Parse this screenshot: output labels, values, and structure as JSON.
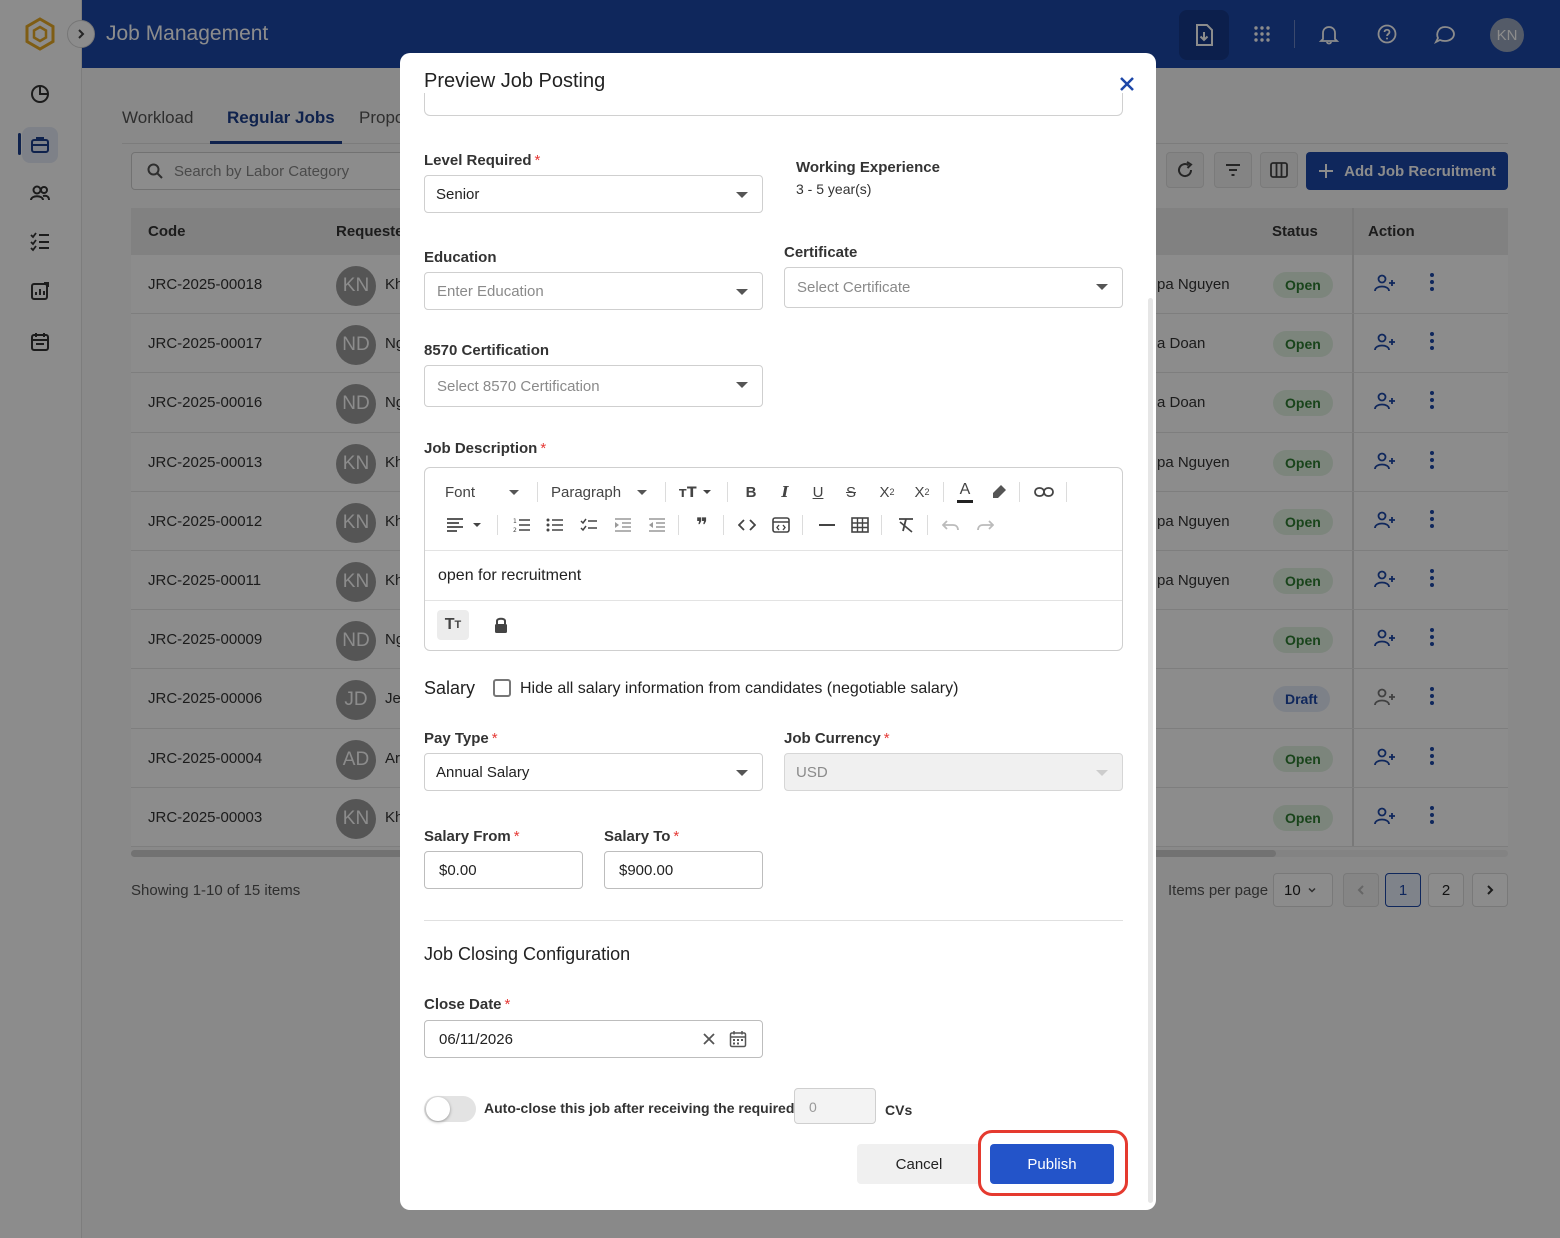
{
  "app": {
    "title": "Job Management",
    "user_initials": "KN",
    "brand_color": "#1d47a8"
  },
  "sidebar": {
    "icons": [
      "dashboard-icon",
      "briefcase-icon",
      "users-icon",
      "checklist-icon",
      "report-icon",
      "calendar-icon"
    ]
  },
  "tabs": [
    {
      "label": "Workload"
    },
    {
      "label": "Regular Jobs"
    },
    {
      "label": "Propo"
    }
  ],
  "search": {
    "placeholder": "Search by Labor Category"
  },
  "toolbar": {
    "add_label": "Add Job Recruitment"
  },
  "table": {
    "headers": {
      "code": "Code",
      "requester": "Requeste",
      "status": "Status",
      "action": "Action"
    },
    "rows": [
      {
        "code": "JRC-2025-00018",
        "initials": "KN",
        "name": "Kh",
        "requester": "pa Nguyen",
        "status": "Open"
      },
      {
        "code": "JRC-2025-00017",
        "initials": "ND",
        "name": "Ng",
        "requester": "a Doan",
        "status": "Open"
      },
      {
        "code": "JRC-2025-00016",
        "initials": "ND",
        "name": "Ng",
        "requester": "a Doan",
        "status": "Open"
      },
      {
        "code": "JRC-2025-00013",
        "initials": "KN",
        "name": "Kh",
        "requester": "pa Nguyen",
        "status": "Open"
      },
      {
        "code": "JRC-2025-00012",
        "initials": "KN",
        "name": "Kh",
        "requester": "pa Nguyen",
        "status": "Open"
      },
      {
        "code": "JRC-2025-00011",
        "initials": "KN",
        "name": "Kh",
        "requester": "pa Nguyen",
        "status": "Open"
      },
      {
        "code": "JRC-2025-00009",
        "initials": "ND",
        "name": "Ng",
        "requester": "",
        "status": "Open"
      },
      {
        "code": "JRC-2025-00006",
        "initials": "JD",
        "name": "Je",
        "requester": "",
        "status": "Draft"
      },
      {
        "code": "JRC-2025-00004",
        "initials": "AD",
        "name": "Ar",
        "requester": "",
        "status": "Open"
      },
      {
        "code": "JRC-2025-00003",
        "initials": "KN",
        "name": "Kh",
        "requester": "",
        "status": "Open"
      }
    ]
  },
  "pagination": {
    "showing": "Showing 1-10 of 15 items",
    "items_per_page_label": "Items per page",
    "items_per_page": "10",
    "pages": [
      "1",
      "2"
    ],
    "current_page": "1"
  },
  "modal": {
    "title": "Preview Job Posting",
    "level_required": {
      "label": "Level Required",
      "value": "Senior"
    },
    "working_experience": {
      "label": "Working Experience",
      "value": "3 - 5 year(s)"
    },
    "education": {
      "label": "Education",
      "placeholder": "Enter Education"
    },
    "certificate": {
      "label": "Certificate",
      "placeholder": "Select Certificate"
    },
    "cert_8570": {
      "label": "8570 Certification",
      "placeholder": "Select 8570 Certification"
    },
    "job_description": {
      "label": "Job Description",
      "font_label": "Font",
      "paragraph_label": "Paragraph",
      "content": "open for recruitment"
    },
    "salary": {
      "title": "Salary",
      "hide_label": "Hide all salary information from candidates (negotiable salary)",
      "hide_checked": false,
      "pay_type_label": "Pay Type",
      "pay_type": "Annual Salary",
      "currency_label": "Job Currency",
      "currency": "USD",
      "from_label": "Salary From",
      "from": "$0.00",
      "to_label": "Salary To",
      "to": "$900.00"
    },
    "closing": {
      "title": "Job Closing Configuration",
      "close_date_label": "Close Date",
      "close_date": "06/11/2026",
      "auto_close_label": "Auto-close this job after receiving the required",
      "auto_close_enabled": false,
      "cv_count": "0",
      "cv_suffix": "CVs"
    },
    "buttons": {
      "cancel": "Cancel",
      "publish": "Publish"
    },
    "highlight_color": "#e53a2f"
  }
}
